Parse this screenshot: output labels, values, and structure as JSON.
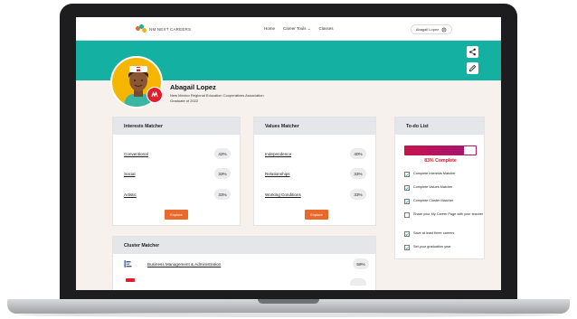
{
  "nav": {
    "logo_text": "NM NEXT CAREERS",
    "links": [
      "Home",
      "Career Tools ⌄",
      "Classes"
    ],
    "user": "Abagail Lopez"
  },
  "profile": {
    "name": "Abagail Lopez",
    "organization": "New Mexico Regional Education Cooperatives Association",
    "graduation": "Graduate of 2022"
  },
  "interests": {
    "title": "Interests Matcher",
    "items": [
      {
        "label": "Conventional",
        "pct": "42%"
      },
      {
        "label": "Social",
        "pct": "33%"
      },
      {
        "label": "Artistic",
        "pct": "33%"
      }
    ],
    "button": "Explore"
  },
  "values": {
    "title": "Values Matcher",
    "items": [
      {
        "label": "Independence",
        "pct": "40%"
      },
      {
        "label": "Relationships",
        "pct": "33%"
      },
      {
        "label": "Working Conditions",
        "pct": "33%"
      }
    ],
    "button": "Explore"
  },
  "todo": {
    "title": "To-do List",
    "progress": 0.83,
    "complete_text": "83% Complete",
    "items": [
      {
        "label": "Complete Interests Matcher",
        "checked": true
      },
      {
        "label": "Complete Values Matcher",
        "checked": true
      },
      {
        "label": "Complete Cluster Matcher",
        "checked": true
      },
      {
        "label": "Share your My Career Page with your teacher",
        "checked": false
      },
      {
        "label": "Save at least three careers",
        "checked": true
      },
      {
        "label": "Set your graduation year",
        "checked": true
      }
    ]
  },
  "cluster": {
    "title": "Cluster Matcher",
    "items": [
      {
        "label": "Business Management & Administration",
        "pct": "59%"
      }
    ]
  },
  "colors": {
    "banner": "#14b1a3",
    "accent": "#e8692a",
    "progress": "#c8144a",
    "avatar_bg": "#f6b600"
  }
}
